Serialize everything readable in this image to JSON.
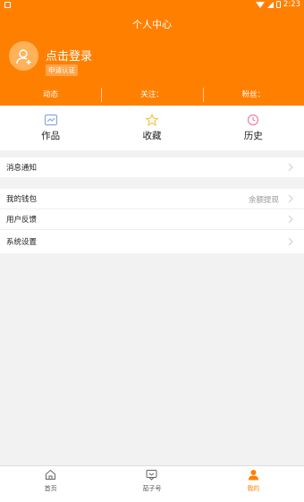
{
  "status_bar": {
    "time": "2:23"
  },
  "header": {
    "title": "个人中心",
    "login_text": "点击登录",
    "verify_badge": "申请认证",
    "stats": [
      {
        "label": "动态"
      },
      {
        "label": "关注："
      },
      {
        "label": "粉丝："
      }
    ]
  },
  "quick_actions": [
    {
      "label": "作品",
      "icon": "works-icon",
      "color": "#8aa9d6"
    },
    {
      "label": "收藏",
      "icon": "star-icon",
      "color": "#f3c24a"
    },
    {
      "label": "历史",
      "icon": "clock-icon",
      "color": "#f07fa8"
    }
  ],
  "menu": {
    "notifications": "消息通知",
    "wallet": "我的钱包",
    "wallet_extra": "余额提现",
    "feedback": "用户反馈",
    "settings": "系统设置"
  },
  "tabs": [
    {
      "label": "首页",
      "icon": "home-icon"
    },
    {
      "label": "茄子号",
      "icon": "message-icon"
    },
    {
      "label": "我的",
      "icon": "user-icon",
      "active": true
    }
  ],
  "colors": {
    "accent": "#ff8000",
    "background": "#f2f2f2"
  }
}
